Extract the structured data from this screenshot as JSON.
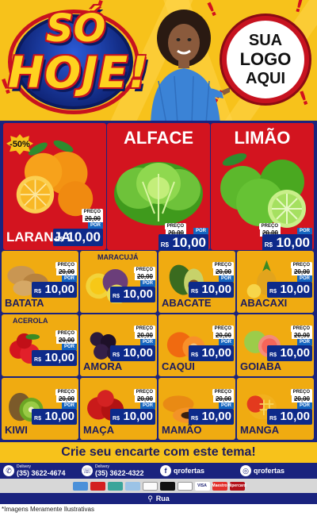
{
  "header": {
    "headline_line1": "SÓ",
    "headline_line2": "HOJE!",
    "logo_lines": [
      "SUA",
      "LOGO",
      "AQUI"
    ]
  },
  "featured": [
    {
      "name": "LARANJA",
      "badge": "-50%",
      "price_label": "PREÇO",
      "old_price": "20,00",
      "por": "POR",
      "currency": "R$",
      "new_price": "10,00",
      "unit": "KG",
      "icon": "orange-icon"
    },
    {
      "name": "ALFACE",
      "price_label": "PREÇO",
      "old_price": "20,00",
      "por": "POR",
      "currency": "R$",
      "new_price": "10,00",
      "unit": "UNID",
      "icon": "lettuce-icon"
    },
    {
      "name": "LIMÃO",
      "price_label": "PREÇO",
      "old_price": "20,00",
      "por": "POR",
      "currency": "R$",
      "new_price": "10,00",
      "unit": "KG",
      "icon": "lime-icon"
    }
  ],
  "products": [
    {
      "name": "BATATA",
      "price_label": "PREÇO",
      "old_price": "20,00",
      "por": "POR",
      "currency": "R$",
      "new_price": "10,00",
      "unit": "KG",
      "icon": "potato-icon"
    },
    {
      "name": "MARACUJÁ",
      "price_label": "PREÇO",
      "old_price": "20,00",
      "por": "POR",
      "currency": "R$",
      "new_price": "10,00",
      "unit": "KG",
      "icon": "passionfruit-icon"
    },
    {
      "name": "ABACATE",
      "price_label": "PREÇO",
      "old_price": "20,00",
      "por": "POR",
      "currency": "R$",
      "new_price": "10,00",
      "unit": "KG",
      "icon": "avocado-icon"
    },
    {
      "name": "ABACAXI",
      "price_label": "PREÇO",
      "old_price": "20,00",
      "por": "POR",
      "currency": "R$",
      "new_price": "10,00",
      "unit": "UNID",
      "icon": "pineapple-icon"
    },
    {
      "name": "ACEROLA",
      "price_label": "PREÇO",
      "old_price": "20,00",
      "por": "POR",
      "currency": "R$",
      "new_price": "10,00",
      "unit": "KG",
      "icon": "acerola-icon"
    },
    {
      "name": "AMORA",
      "price_label": "PREÇO",
      "old_price": "20,00",
      "por": "POR",
      "currency": "R$",
      "new_price": "10,00",
      "unit": "KG",
      "icon": "blackberry-icon"
    },
    {
      "name": "CAQUI",
      "price_label": "PREÇO",
      "old_price": "20,00",
      "por": "POR",
      "currency": "R$",
      "new_price": "10,00",
      "unit": "KG",
      "icon": "persimmon-icon"
    },
    {
      "name": "GOIABA",
      "price_label": "PREÇO",
      "old_price": "20,00",
      "por": "POR",
      "currency": "R$",
      "new_price": "10,00",
      "unit": "KG",
      "icon": "guava-icon"
    },
    {
      "name": "KIWI",
      "price_label": "PREÇO",
      "old_price": "20,00",
      "por": "POR",
      "currency": "R$",
      "new_price": "10,00",
      "unit": "KG",
      "icon": "kiwi-icon"
    },
    {
      "name": "MAÇA",
      "price_label": "PREÇO",
      "old_price": "20,00",
      "por": "POR",
      "currency": "R$",
      "new_price": "10,00",
      "unit": "KG",
      "icon": "apple-icon"
    },
    {
      "name": "MAMÃO",
      "price_label": "PREÇO",
      "old_price": "20,00",
      "por": "POR",
      "currency": "R$",
      "new_price": "10,00",
      "unit": "KG",
      "icon": "papaya-icon"
    },
    {
      "name": "MANGA",
      "price_label": "PREÇO",
      "old_price": "20,00",
      "por": "POR",
      "currency": "R$",
      "new_price": "10,00",
      "unit": "KG",
      "icon": "mango-icon"
    }
  ],
  "cta": "Crie seu encarte com este tema!",
  "contacts": {
    "whatsapp_label": "Delivery",
    "whatsapp": "(35) 3622-4674",
    "phone_label": "Delivery",
    "phone": "(35) 3622-4322",
    "facebook": "qrofertas",
    "instagram": "qrofertas"
  },
  "payments": [
    "VISA",
    "Maestro",
    "Hipercard"
  ],
  "address": "Rua",
  "disclaimer": "*Imagens Meramente Ilustrativas",
  "colors": {
    "yellow": "#f7c21b",
    "red": "#d3141f",
    "navy": "#1a237e",
    "orange_card": "#f0ab11"
  }
}
